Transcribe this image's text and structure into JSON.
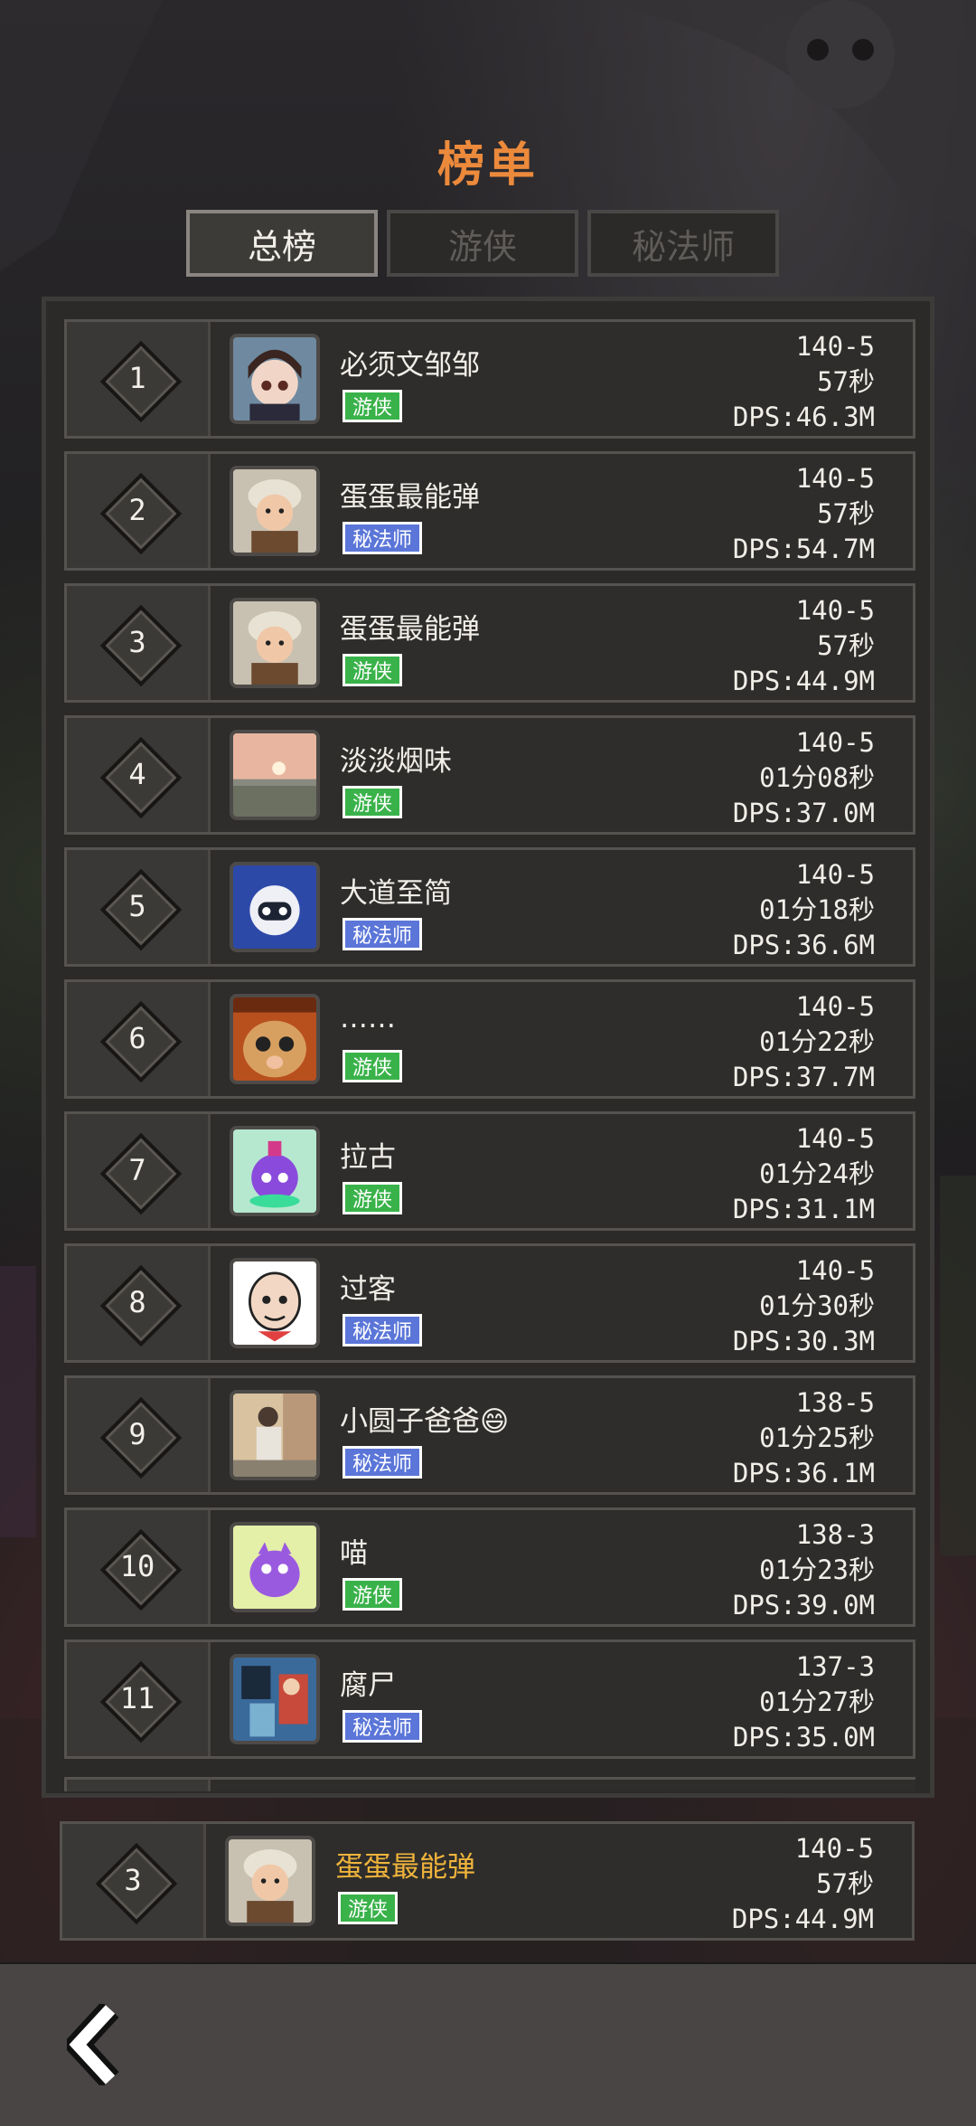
{
  "title": "榜单",
  "tabs": [
    {
      "label": "总榜",
      "active": true
    },
    {
      "label": "游侠",
      "active": false
    },
    {
      "label": "秘法师",
      "active": false
    }
  ],
  "classes": {
    "ranger": "游侠",
    "mage": "秘法师"
  },
  "entries": [
    {
      "rank": "1",
      "name": "必须文邹邹",
      "class": "游侠",
      "class_key": "ranger",
      "level": "140-5",
      "time": "57秒",
      "dps": "DPS:46.3M",
      "avatar": "doll-avatar"
    },
    {
      "rank": "2",
      "name": "蛋蛋最能弹",
      "class": "秘法师",
      "class_key": "mage",
      "level": "140-5",
      "time": "57秒",
      "dps": "DPS:54.7M",
      "avatar": "baby-avatar"
    },
    {
      "rank": "3",
      "name": "蛋蛋最能弹",
      "class": "游侠",
      "class_key": "ranger",
      "level": "140-5",
      "time": "57秒",
      "dps": "DPS:44.9M",
      "avatar": "baby-avatar"
    },
    {
      "rank": "4",
      "name": "淡淡烟味",
      "class": "游侠",
      "class_key": "ranger",
      "level": "140-5",
      "time": "01分08秒",
      "dps": "DPS:37.0M",
      "avatar": "sunset-avatar"
    },
    {
      "rank": "5",
      "name": "大道至简",
      "class": "秘法师",
      "class_key": "mage",
      "level": "140-5",
      "time": "01分18秒",
      "dps": "DPS:36.6M",
      "avatar": "robot-avatar"
    },
    {
      "rank": "6",
      "name": "……",
      "class": "游侠",
      "class_key": "ranger",
      "level": "140-5",
      "time": "01分22秒",
      "dps": "DPS:37.7M",
      "avatar": "cat-avatar"
    },
    {
      "rank": "7",
      "name": "拉古",
      "class": "游侠",
      "class_key": "ranger",
      "level": "140-5",
      "time": "01分24秒",
      "dps": "DPS:31.1M",
      "avatar": "potion-avatar"
    },
    {
      "rank": "8",
      "name": "过客",
      "class": "秘法师",
      "class_key": "mage",
      "level": "140-5",
      "time": "01分30秒",
      "dps": "DPS:30.3M",
      "avatar": "cartoon-avatar"
    },
    {
      "rank": "9",
      "name": "小圆子爸爸😄",
      "class": "秘法师",
      "class_key": "mage",
      "level": "138-5",
      "time": "01分25秒",
      "dps": "DPS:36.1M",
      "avatar": "child-avatar"
    },
    {
      "rank": "10",
      "name": "喵",
      "class": "游侠",
      "class_key": "ranger",
      "level": "138-3",
      "time": "01分23秒",
      "dps": "DPS:39.0M",
      "avatar": "monster-avatar"
    },
    {
      "rank": "11",
      "name": "腐尸",
      "class": "秘法师",
      "class_key": "mage",
      "level": "137-3",
      "time": "01分27秒",
      "dps": "DPS:35.0M",
      "avatar": "comic-avatar"
    }
  ],
  "my_entry": {
    "rank": "3",
    "name": "蛋蛋最能弹",
    "class": "游侠",
    "class_key": "ranger",
    "level": "140-5",
    "time": "57秒",
    "dps": "DPS:44.9M",
    "avatar": "baby-avatar"
  },
  "colors": {
    "title": "#ec8a3c",
    "ranger": "#3ab24a",
    "mage": "#5b76d8",
    "highlight_name": "#f0b43c"
  }
}
